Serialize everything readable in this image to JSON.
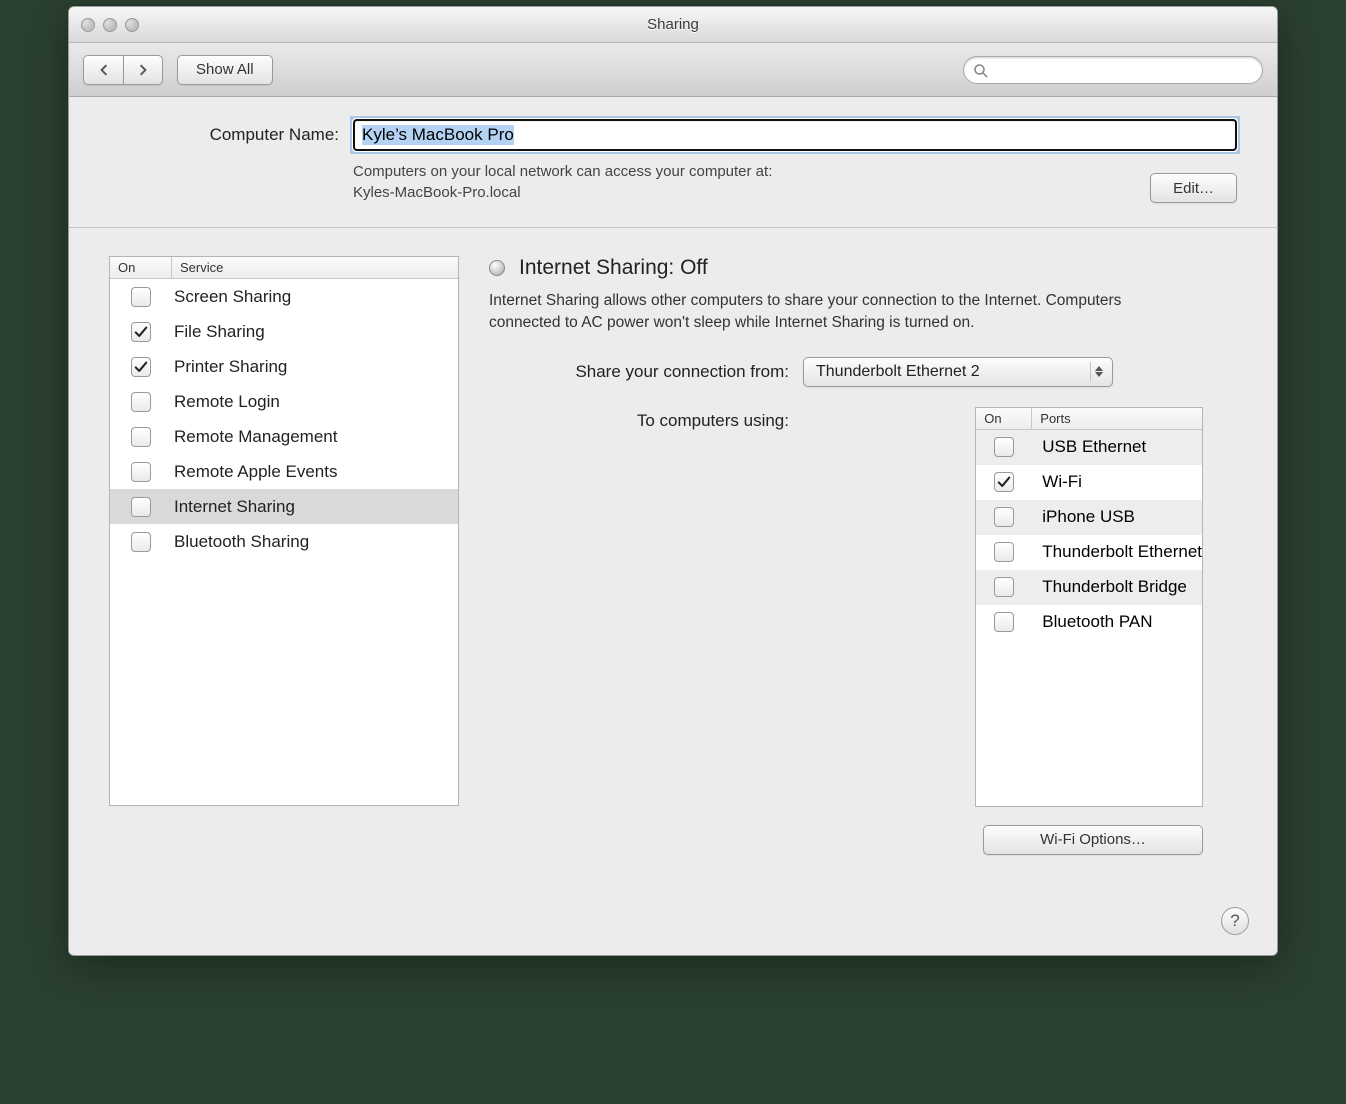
{
  "window": {
    "title": "Sharing"
  },
  "toolbar": {
    "show_all": "Show All",
    "search_placeholder": ""
  },
  "computer_name": {
    "label": "Computer Name:",
    "value": "Kyle’s MacBook Pro",
    "hint_line1": "Computers on your local network can access your computer at:",
    "hint_line2": "Kyles-MacBook-Pro.local",
    "edit": "Edit…"
  },
  "services": {
    "cols": {
      "on": "On",
      "service": "Service"
    },
    "items": [
      {
        "label": "Screen Sharing",
        "checked": false,
        "selected": false
      },
      {
        "label": "File Sharing",
        "checked": true,
        "selected": false
      },
      {
        "label": "Printer Sharing",
        "checked": true,
        "selected": false
      },
      {
        "label": "Remote Login",
        "checked": false,
        "selected": false
      },
      {
        "label": "Remote Management",
        "checked": false,
        "selected": false
      },
      {
        "label": "Remote Apple Events",
        "checked": false,
        "selected": false
      },
      {
        "label": "Internet Sharing",
        "checked": false,
        "selected": true
      },
      {
        "label": "Bluetooth Sharing",
        "checked": false,
        "selected": false
      }
    ]
  },
  "detail": {
    "status_title": "Internet Sharing: Off",
    "description": "Internet Sharing allows other computers to share your connection to the Internet. Computers connected to AC power won't sleep while Internet Sharing is turned on.",
    "share_from_label": "Share your connection from:",
    "share_from_value": "Thunderbolt Ethernet 2",
    "ports_label": "To computers using:",
    "ports_cols": {
      "on": "On",
      "ports": "Ports"
    },
    "ports": [
      {
        "label": "USB Ethernet",
        "checked": false
      },
      {
        "label": "Wi-Fi",
        "checked": true
      },
      {
        "label": "iPhone USB",
        "checked": false
      },
      {
        "label": "Thunderbolt Ethernet",
        "checked": false
      },
      {
        "label": "Thunderbolt Bridge",
        "checked": false
      },
      {
        "label": "Bluetooth PAN",
        "checked": false
      }
    ],
    "wifi_options": "Wi-Fi Options…"
  },
  "help": "?"
}
